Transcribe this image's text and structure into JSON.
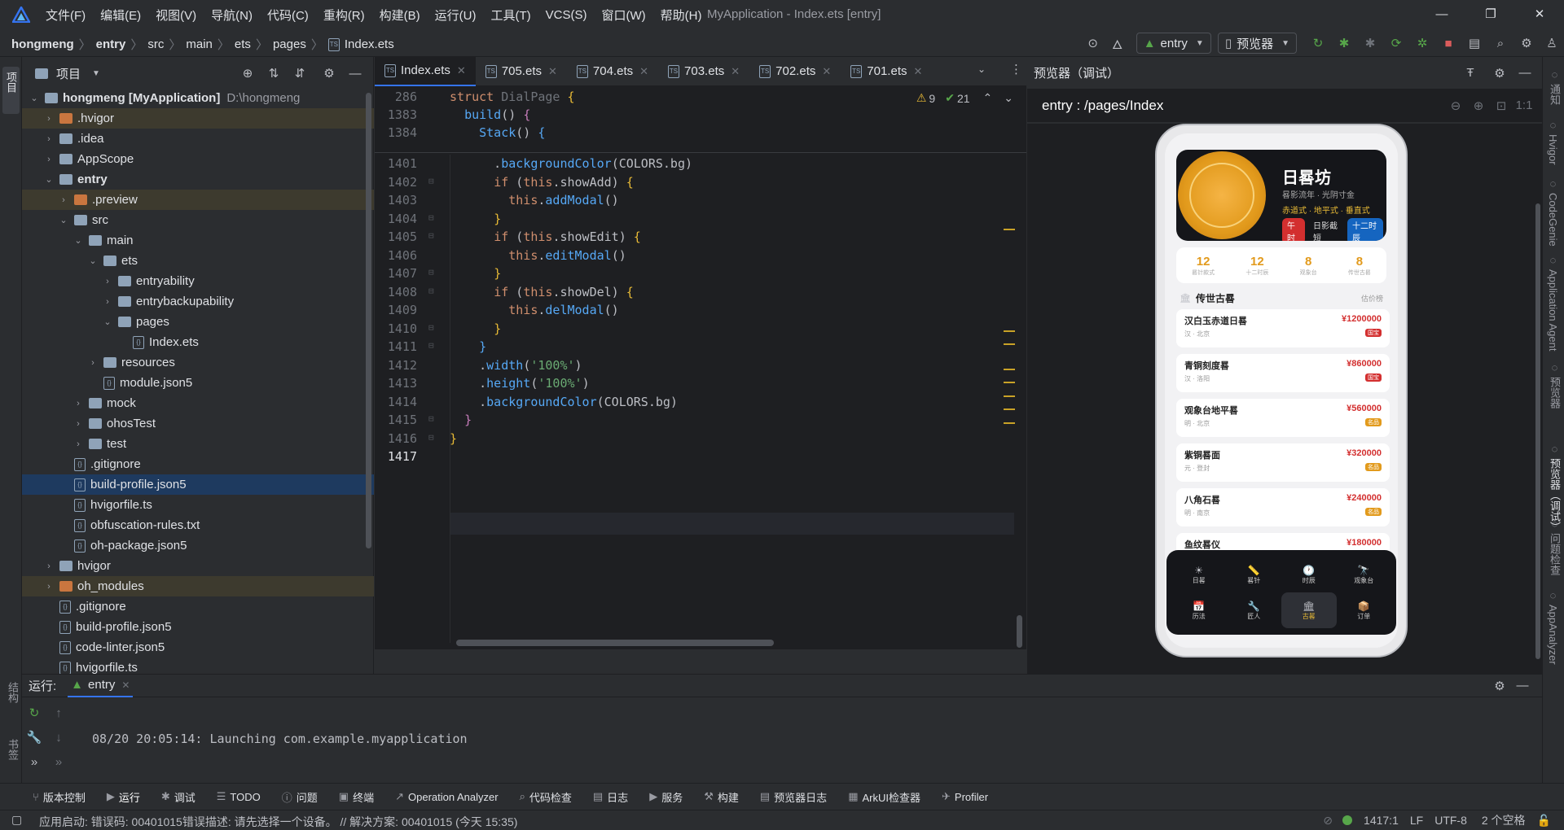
{
  "app": {
    "window_title": "MyApplication - Index.ets [entry]",
    "menu": [
      "文件(F)",
      "编辑(E)",
      "视图(V)",
      "导航(N)",
      "代码(C)",
      "重构(R)",
      "构建(B)",
      "运行(U)",
      "工具(T)",
      "VCS(S)",
      "窗口(W)",
      "帮助(H)"
    ]
  },
  "breadcrumb": [
    "hongmeng",
    "entry",
    "src",
    "main",
    "ets",
    "pages",
    "Index.ets"
  ],
  "toolbar": {
    "run_config": "entry",
    "device": "预览器"
  },
  "left_strip": {
    "project": "项目",
    "structure": "结构",
    "bookmarks": "书签"
  },
  "right_strip": [
    "通知",
    "Hvigor",
    "CodeGenie",
    "Application Agent",
    "预览器",
    "预览器（调试）",
    "问题检查",
    "AppAnalyzer"
  ],
  "project": {
    "title": "项目",
    "tree": [
      {
        "label": "hongmeng [MyApplication]",
        "extra": "D:\\hongmeng",
        "depth": 0,
        "arrow": "v",
        "type": "folder"
      },
      {
        "label": ".hvigor",
        "depth": 1,
        "arrow": ">",
        "type": "folder-orange",
        "state": "ex"
      },
      {
        "label": ".idea",
        "depth": 1,
        "arrow": ">",
        "type": "folder"
      },
      {
        "label": "AppScope",
        "depth": 1,
        "arrow": ">",
        "type": "folder"
      },
      {
        "label": "entry",
        "depth": 1,
        "arrow": "v",
        "type": "folder"
      },
      {
        "label": ".preview",
        "depth": 2,
        "arrow": ">",
        "type": "folder-orange",
        "state": "ex"
      },
      {
        "label": "src",
        "depth": 2,
        "arrow": "v",
        "type": "folder"
      },
      {
        "label": "main",
        "depth": 3,
        "arrow": "v",
        "type": "folder"
      },
      {
        "label": "ets",
        "depth": 4,
        "arrow": "v",
        "type": "folder"
      },
      {
        "label": "entryability",
        "depth": 5,
        "arrow": ">",
        "type": "folder"
      },
      {
        "label": "entrybackupability",
        "depth": 5,
        "arrow": ">",
        "type": "folder"
      },
      {
        "label": "pages",
        "depth": 5,
        "arrow": "v",
        "type": "folder"
      },
      {
        "label": "Index.ets",
        "depth": 6,
        "arrow": "",
        "type": "file"
      },
      {
        "label": "resources",
        "depth": 4,
        "arrow": ">",
        "type": "folder"
      },
      {
        "label": "module.json5",
        "depth": 4,
        "arrow": "",
        "type": "file"
      },
      {
        "label": "mock",
        "depth": 3,
        "arrow": ">",
        "type": "folder"
      },
      {
        "label": "ohosTest",
        "depth": 3,
        "arrow": ">",
        "type": "folder"
      },
      {
        "label": "test",
        "depth": 3,
        "arrow": ">",
        "type": "folder"
      },
      {
        "label": ".gitignore",
        "depth": 2,
        "arrow": "",
        "type": "file"
      },
      {
        "label": "build-profile.json5",
        "depth": 2,
        "arrow": "",
        "type": "file",
        "state": "sel"
      },
      {
        "label": "hvigorfile.ts",
        "depth": 2,
        "arrow": "",
        "type": "file"
      },
      {
        "label": "obfuscation-rules.txt",
        "depth": 2,
        "arrow": "",
        "type": "file"
      },
      {
        "label": "oh-package.json5",
        "depth": 2,
        "arrow": "",
        "type": "file"
      },
      {
        "label": "hvigor",
        "depth": 1,
        "arrow": ">",
        "type": "folder"
      },
      {
        "label": "oh_modules",
        "depth": 1,
        "arrow": ">",
        "type": "folder-orange",
        "state": "ex"
      },
      {
        "label": ".gitignore",
        "depth": 1,
        "arrow": "",
        "type": "file"
      },
      {
        "label": "build-profile.json5",
        "depth": 1,
        "arrow": "",
        "type": "file"
      },
      {
        "label": "code-linter.json5",
        "depth": 1,
        "arrow": "",
        "type": "file"
      },
      {
        "label": "hvigorfile.ts",
        "depth": 1,
        "arrow": "",
        "type": "file"
      }
    ]
  },
  "editor": {
    "tabs": [
      "Index.ets",
      "705.ets",
      "704.ets",
      "703.ets",
      "702.ets",
      "701.ets"
    ],
    "warnings": "9",
    "ok": "21",
    "sticky": [
      {
        "num": "286",
        "html": "<span class='kw'>struct</span> <span class='ty'>DialPage</span> <span class='yel'>{</span>"
      },
      {
        "num": "1383",
        "html": "  <span class='fn'>build</span>() <span class='cls'>{</span>"
      },
      {
        "num": "1384",
        "html": "    <span class='fn'>Stack</span>() <span class='fn'>{</span>"
      }
    ],
    "lines": [
      {
        "num": "1401",
        "html": "      .<span class='fn'>backgroundColor</span>(COLORS.bg)"
      },
      {
        "num": "1402",
        "html": "      <span class='kw'>if</span> (<span class='kw'>this</span>.showAdd) <span class='yel'>{</span>"
      },
      {
        "num": "1403",
        "html": "        <span class='kw'>this</span>.<span class='fn'>addModal</span>()"
      },
      {
        "num": "1404",
        "html": "      <span class='yel'>}</span>"
      },
      {
        "num": "1405",
        "html": "      <span class='kw'>if</span> (<span class='kw'>this</span>.showEdit) <span class='yel'>{</span>"
      },
      {
        "num": "1406",
        "html": "        <span class='kw'>this</span>.<span class='fn'>editModal</span>()"
      },
      {
        "num": "1407",
        "html": "      <span class='yel'>}</span>"
      },
      {
        "num": "1408",
        "html": "      <span class='kw'>if</span> (<span class='kw'>this</span>.showDel) <span class='yel'>{</span>"
      },
      {
        "num": "1409",
        "html": "        <span class='kw'>this</span>.<span class='fn'>delModal</span>()"
      },
      {
        "num": "1410",
        "html": "      <span class='yel'>}</span>"
      },
      {
        "num": "1411",
        "html": "    <span class='fn'>}</span>"
      },
      {
        "num": "1412",
        "html": "    .<span class='fn'>width</span>(<span class='str'>'100%'</span>)"
      },
      {
        "num": "1413",
        "html": "    .<span class='fn'>height</span>(<span class='str'>'100%'</span>)"
      },
      {
        "num": "1414",
        "html": "    .<span class='fn'>backgroundColor</span>(COLORS.bg)"
      },
      {
        "num": "1415",
        "html": "  <span class='cls'>}</span>"
      },
      {
        "num": "1416",
        "html": "<span class='yel'>}</span>"
      },
      {
        "num": "1417",
        "html": ""
      }
    ]
  },
  "preview": {
    "title": "预览器（调试）",
    "path": "entry : /pages/Index",
    "app": {
      "name": "日晷坊",
      "sub": "晷影流年 · 光阴寸金",
      "tags": "赤道式 · 地平式 · 垂直式",
      "badges": [
        "午时",
        "日影截短",
        "十二时辰"
      ],
      "stats": [
        {
          "v": "12",
          "l": "晷针款式"
        },
        {
          "v": "12",
          "l": "十二时辰"
        },
        {
          "v": "8",
          "l": "观象台"
        },
        {
          "v": "8",
          "l": "传世古晷"
        }
      ],
      "section": "传世古晷",
      "section_right": "估价榜",
      "items": [
        {
          "name": "汉白玉赤道日晷",
          "loc": "汉 · 北京",
          "price": "¥1200000",
          "tag": "国宝",
          "red": true
        },
        {
          "name": "青铜刻度晷",
          "loc": "汉 · 洛阳",
          "price": "¥860000",
          "tag": "国宝",
          "red": true
        },
        {
          "name": "观象台地平晷",
          "loc": "明 · 北京",
          "price": "¥560000",
          "tag": "名品",
          "red": false
        },
        {
          "name": "紫铜晷面",
          "loc": "元 · 登封",
          "price": "¥320000",
          "tag": "名品",
          "red": false
        },
        {
          "name": "八角石晷",
          "loc": "明 · 南京",
          "price": "¥240000",
          "tag": "名品",
          "red": false
        },
        {
          "name": "鱼纹晷仪",
          "loc": "",
          "price": "¥180000",
          "tag": "",
          "red": false
        }
      ],
      "nav": [
        {
          "i": "☀",
          "l": "日晷"
        },
        {
          "i": "📏",
          "l": "晷针"
        },
        {
          "i": "🕐",
          "l": "时辰"
        },
        {
          "i": "🔭",
          "l": "观象台"
        },
        {
          "i": "📅",
          "l": "历法"
        },
        {
          "i": "🔧",
          "l": "匠人"
        },
        {
          "i": "🏛",
          "l": "古晷",
          "active": true
        },
        {
          "i": "📦",
          "l": "订单"
        }
      ]
    }
  },
  "run": {
    "label": "运行:",
    "tab": "entry",
    "log": "08/20 20:05:14: Launching com.example.myapplication"
  },
  "tools": [
    "版本控制",
    "运行",
    "调试",
    "TODO",
    "问题",
    "终端",
    "Operation Analyzer",
    "代码检查",
    "日志",
    "服务",
    "构建",
    "预览器日志",
    "ArkUI检查器",
    "Profiler"
  ],
  "status": {
    "message": "应用启动: 错误码: 00401015错误描述: 请先选择一个设备。 // 解决方案: 00401015 (今天 15:35)",
    "pos": "1417:1",
    "eol": "LF",
    "enc": "UTF-8",
    "indent": "2 个空格"
  }
}
